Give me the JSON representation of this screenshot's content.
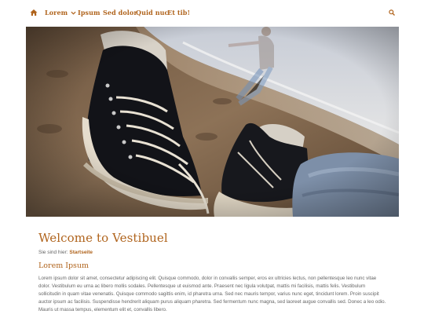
{
  "nav": {
    "home_icon": "home-icon",
    "items": [
      {
        "label": "Lorem",
        "has_dropdown": true
      },
      {
        "label": "Ipsum"
      },
      {
        "label": "Sed dolor"
      },
      {
        "label": "Quid nuc"
      },
      {
        "label": "Et tib!"
      }
    ],
    "search_icon": "search-icon"
  },
  "hero": {
    "description_icon": "hero-photo"
  },
  "page": {
    "title": "Welcome to Vestibuel",
    "breadcrumb_prefix": "Sie sind hier:",
    "breadcrumb_link": "Startseite",
    "section_title": "Lorem Ipsum",
    "body": "Lorem ipsum dolor sit amet, consectetur adipiscing elit. Quisque commodo, dolor in convallis semper, eros ex ultricies lectus, non pellentesque leo nunc vitae dolor. Vestibulum eu urna ac libero mollis sodales. Pellentesque ut euismod ante. Praesent nec ligula volutpat, mattis mi facilisis, mattis felis. Vestibulum sollicitudin in quam vitae venenatis. Quisque commodo sagittis enim, id pharetra urna. Sed nec mauris tempor, varius nunc eget, tincidunt lorem. Proin suscipit auctor ipsum ac facilisis. Suspendisse hendrerit aliquam purus aliquam pharetra. Sed fermentum nunc magna, sed laoreet augue convallis sed. Donec a leo odio. Mauris ut massa tempus, elementum elit et, convallis libero."
  },
  "colors": {
    "accent": "#b0641d",
    "text": "#666666"
  }
}
